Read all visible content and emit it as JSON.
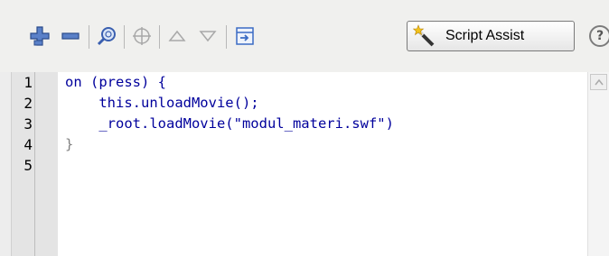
{
  "toolbar": {
    "buttons": [
      {
        "icon": "add-statement-icon"
      },
      {
        "icon": "delete-statement-icon"
      },
      {
        "icon": "find-icon"
      },
      {
        "icon": "target-path-icon"
      },
      {
        "icon": "move-up-icon"
      },
      {
        "icon": "move-down-icon"
      },
      {
        "icon": "insert-target-icon"
      }
    ],
    "script_assist_label": "Script Assist",
    "help_label": "?"
  },
  "editor": {
    "line_numbers": [
      "1",
      "2",
      "3",
      "4",
      "5"
    ],
    "lines": [
      "on (press) {",
      "    this.unloadMovie();",
      "    _root.loadMovie(\"modul_materi.swf\")",
      "}",
      ""
    ]
  }
}
